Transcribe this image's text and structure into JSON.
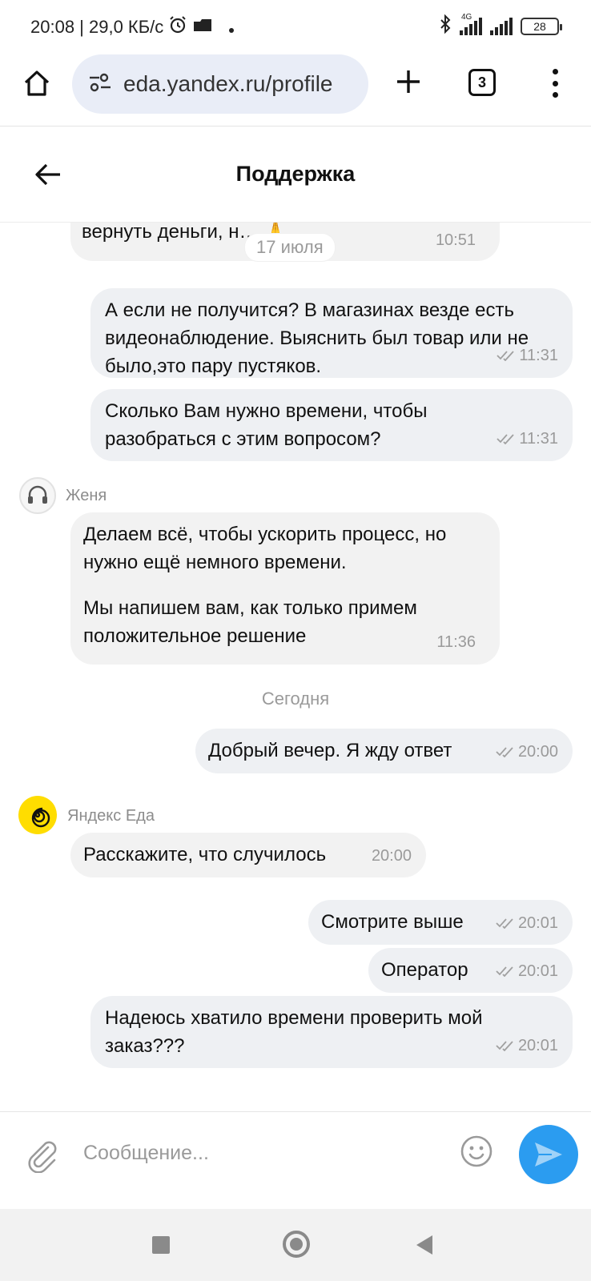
{
  "status_bar": {
    "time_speed": "20:08 | 29,0 КБ/с",
    "network": "4G",
    "battery": "28",
    "icons": [
      "alarm-icon",
      "battery-saver-icon",
      "dot-icon",
      "bluetooth-icon",
      "signal-icon"
    ]
  },
  "browser": {
    "url": "eda.yandex.ru/profile",
    "tab_count": "3",
    "icons": [
      "home-icon",
      "site-settings-icon",
      "plus-icon",
      "tabs-icon",
      "more-vert-icon"
    ]
  },
  "header": {
    "title": "Поддержка"
  },
  "chat": {
    "messages": [
      {
        "side": "in",
        "text": "вернуть деньги, н… 🙏",
        "time": "10:51"
      },
      {
        "side": "out",
        "text": "А если не получится? В магазинах везде есть видеонаблюдение. Выяснить был товар или не было,это пару пустяков.",
        "time": "11:31",
        "read": true
      },
      {
        "side": "out",
        "text": "Сколько Вам нужно времени, чтобы разобраться с этим вопросом?",
        "time": "11:31",
        "read": true
      },
      {
        "side": "in",
        "sender": "Женя",
        "text": "Делаем всё, чтобы ускорить процесс, но нужно ещё немного времени.",
        "text2": "Мы напишем вам, как только примем положительное решение",
        "time": "11:36"
      },
      {
        "side": "out",
        "text": "Добрый вечер. Я жду ответ",
        "time": "20:00",
        "read": true
      },
      {
        "side": "in",
        "sender": "Яндекс Еда",
        "text": "Расскажите, что случилось",
        "time": "20:00"
      },
      {
        "side": "out",
        "text": "Смотрите выше",
        "time": "20:01",
        "read": true
      },
      {
        "side": "out",
        "text": "Оператор",
        "time": "20:01",
        "read": true
      },
      {
        "side": "out",
        "text": "Надеюсь хватило времени проверить мой заказ???",
        "time": "20:01",
        "read": true
      }
    ],
    "date_separators": [
      "17 июля",
      "Сегодня"
    ]
  },
  "composer": {
    "placeholder": "Сообщение...",
    "icons": [
      "paperclip-icon",
      "emoji-icon",
      "send-icon"
    ]
  },
  "colors": {
    "send_button": "#2b9cf0",
    "yandex_avatar": "#ffdd00",
    "bubble_in": "#f2f2f2",
    "bubble_out": "#eef0f3"
  }
}
